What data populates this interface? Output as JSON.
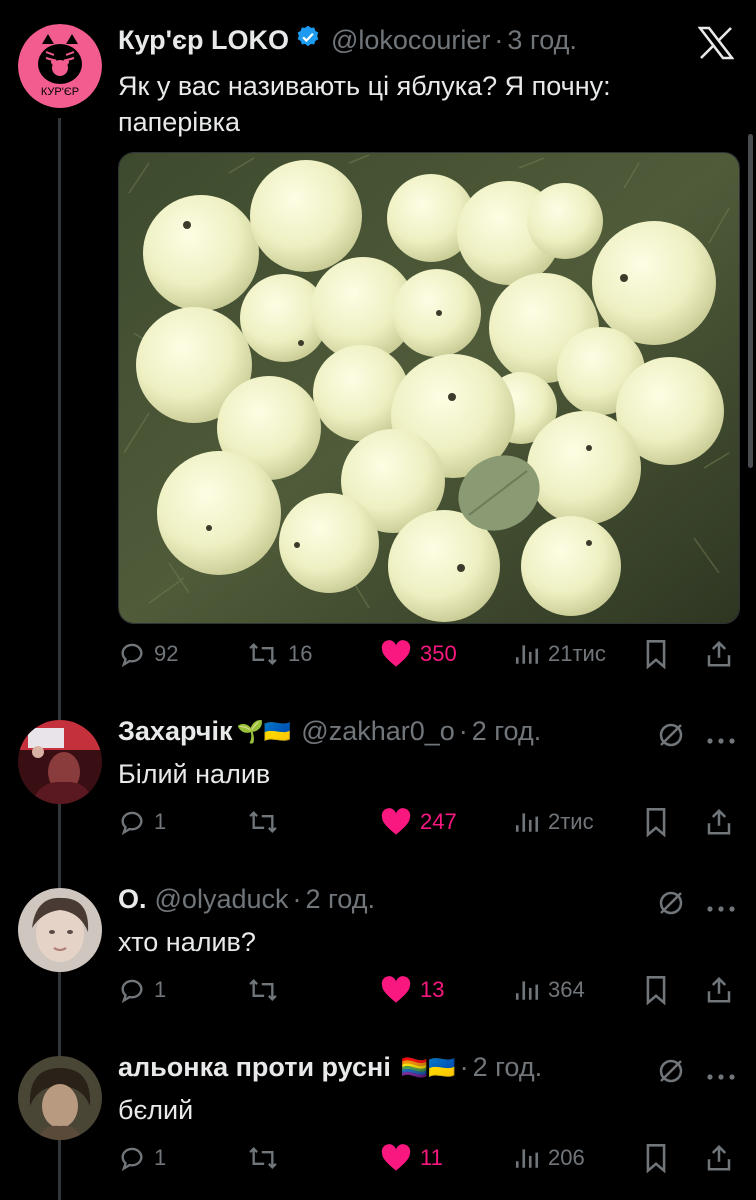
{
  "main_post": {
    "author_name": "Кур'єр LOKO",
    "handle": "@lokocourier",
    "separator": "·",
    "time": "3 год.",
    "text_line1": "Як у вас називають ці яблука? Я почну:",
    "text_line2": "паперівка",
    "avatar_label": "КУР'ЄР",
    "stats": {
      "replies": "92",
      "reposts": "16",
      "likes": "350",
      "views": "21тис"
    }
  },
  "replies": [
    {
      "author_name": "Захарчік",
      "emojis": "🌱🇺🇦",
      "handle": "@zakhar0_o",
      "separator": "·",
      "time": "2 год.",
      "text": "Білий налив",
      "stats": {
        "replies": "1",
        "reposts": "",
        "likes": "247",
        "views": "2тис"
      }
    },
    {
      "author_name": "О.",
      "emojis": "",
      "handle": "@olyaduck",
      "separator": "·",
      "time": "2 год.",
      "text": "хто налив?",
      "stats": {
        "replies": "1",
        "reposts": "",
        "likes": "13",
        "views": "364"
      }
    },
    {
      "author_name": "альонка проти русні",
      "emojis": "🏳️‍🌈🇺🇦",
      "handle": "",
      "separator": "·",
      "time": "2 год.",
      "text": "бєлий",
      "stats": {
        "replies": "1",
        "reposts": "",
        "likes": "11",
        "views": "206"
      }
    }
  ],
  "colors": {
    "background": "#000000",
    "text": "#e7e9ea",
    "muted": "#71767b",
    "like": "#f91880",
    "verified": "#1d9bf0",
    "avatar_pink": "#f25c8f"
  },
  "icons": [
    "x-logo-icon",
    "verified-badge-icon",
    "reply-icon",
    "repost-icon",
    "heart-icon",
    "views-icon",
    "bookmark-icon",
    "share-icon",
    "grok-icon",
    "more-icon"
  ]
}
